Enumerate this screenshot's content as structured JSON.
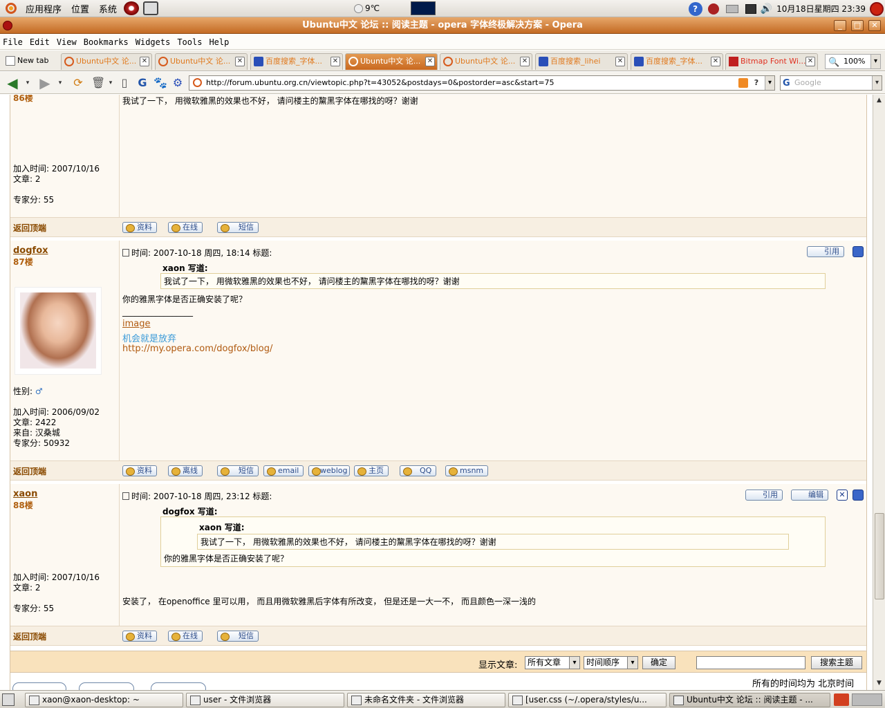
{
  "top_panel": {
    "menus": [
      "应用程序",
      "位置",
      "系统"
    ],
    "weather": "9℃",
    "clock": "10月18日星期四 23:39"
  },
  "window": {
    "title": "Ubuntu中文 论坛 :: 阅读主题 -  opera 字体终极解决方案 -  Opera"
  },
  "menubar": [
    "File",
    "Edit",
    "View",
    "Bookmarks",
    "Widgets",
    "Tools",
    "Help"
  ],
  "tabs": [
    {
      "label": "New tab"
    },
    {
      "label": "Ubuntu中文 论..."
    },
    {
      "label": "Ubuntu中文 论..."
    },
    {
      "label": "百度搜索_字体..."
    },
    {
      "label": "Ubuntu中文 论..."
    },
    {
      "label": "Ubuntu中文 论..."
    },
    {
      "label": "百度搜索_lihei"
    },
    {
      "label": "百度搜索_字体..."
    },
    {
      "label": "Bitmap Font Wi..."
    }
  ],
  "zoom": "100%",
  "address": {
    "url": "http://forum.ubuntu.org.cn/viewtopic.php?t=43052&postdays=0&postorder=asc&start=75",
    "search_placeholder": "Google"
  },
  "posts": [
    {
      "floor": "86楼",
      "text": "我试了一下，  用微软雅黑的效果也不好，  请问楼主的黧黑字体在哪找的呀？谢谢",
      "join": "加入时间:  2007/10/16",
      "articles": "文章:  2",
      "score": "专家分: 55",
      "back_top": "返回顶端",
      "buttons": [
        "资料",
        "在线",
        "短信"
      ]
    },
    {
      "user": "dogfox",
      "floor": "87楼",
      "meta": "时间:  2007-10-18  周四, 18:14     标题:",
      "quote_author": "xaon  写道:",
      "quote_text": "我试了一下，  用微软雅黑的效果也不好，  请问楼主的黧黑字体在哪找的呀？谢谢",
      "text": "你的雅黑字体是否正确安装了呢？",
      "signature_line": "_________________",
      "sig_image": "image",
      "sig_motto": "机会就是放弃",
      "sig_url": "http://my.opera.com/dogfox/blog/",
      "gender": "性别:",
      "join": "加入时间:  2006/09/02",
      "articles": "文章:  2422",
      "from": "来自:  汉桑城",
      "score": "专家分: 50932",
      "quote_btn": "引用",
      "back_top": "返回顶端",
      "buttons": [
        "资料",
        "离线",
        "短信",
        "email",
        "weblog",
        "主页",
        "QQ",
        "msnm"
      ]
    },
    {
      "user": "xaon",
      "floor": "88楼",
      "meta": "时间:  2007-10-18  周四, 23:12     标题:",
      "quote_author": "dogfox  写道:",
      "inner_quote_author": "xaon  写道:",
      "inner_quote_text": "我试了一下，  用微软雅黑的效果也不好，  请问楼主的黧黑字体在哪找的呀？谢谢",
      "quote_text": "你的雅黑字体是否正确安装了呢？",
      "text": "安装了，  在openoffice  里可以用，  而且用微软雅黑后字体有所改变，  但是还是一大一不，  而且颜色一深一浅的",
      "join": "加入时间:  2007/10/16",
      "articles": "文章:  2",
      "score": "专家分: 55",
      "quote_btn": "引用",
      "edit_btn": "编辑",
      "back_top": "返回顶端",
      "buttons": [
        "资料",
        "在线",
        "短信"
      ]
    }
  ],
  "bottom": {
    "show_label": "显示文章:",
    "filter_value": "所有文章",
    "order_value": "时间顺序",
    "confirm": "确定",
    "search_btn": "搜索主题",
    "timezone": "所有的时间均为  北京时间"
  },
  "taskbar": [
    {
      "label": "xaon@xaon-desktop: ~"
    },
    {
      "label": "user - 文件浏览器"
    },
    {
      "label": "未命名文件夹 - 文件浏览器"
    },
    {
      "label": "[user.css (~/.opera/styles/u..."
    },
    {
      "label": "Ubuntu中文 论坛 :: 阅读主题 - ..."
    }
  ]
}
